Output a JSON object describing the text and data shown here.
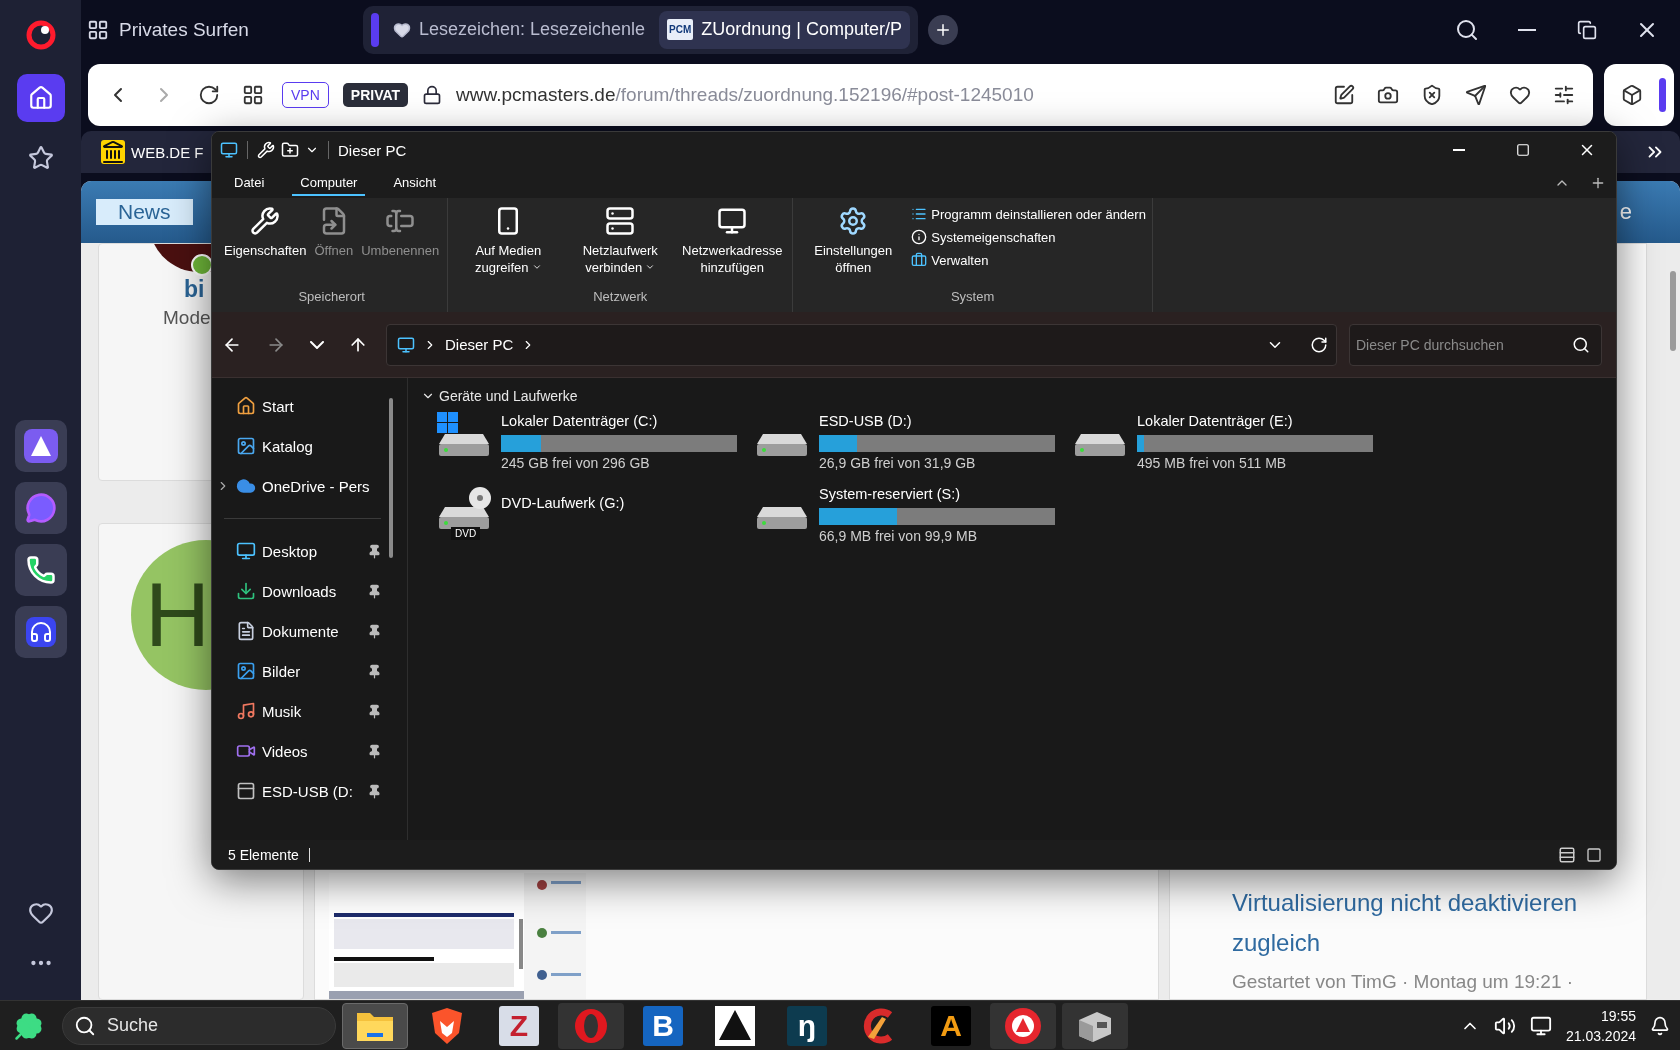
{
  "sidebar": {
    "items": [
      {
        "selected": true
      },
      {
        "selected": false
      }
    ]
  },
  "tab_bar": {
    "private_label": "Privates Surfen",
    "tabs": [
      {
        "title": "Lesezeichen: Lesezeichenle",
        "selected": false
      },
      {
        "favicon": "PCM",
        "title": "ZUordnung | Computer/P",
        "selected": true
      }
    ]
  },
  "address_bar": {
    "badges": [
      "VPN",
      "PRIVAT"
    ],
    "url_host": "www.pcmasters.de",
    "url_path": "/forum/threads/zuordnung.152196/#post-1245010"
  },
  "bookmarks": [
    "WEB.DE F"
  ],
  "page": {
    "tab": "News",
    "header_right": "e",
    "profile": {
      "name": "bi",
      "role": "Mode"
    },
    "avatar_letter": "H",
    "thread": {
      "title": "Virtualisierung nicht deaktivieren zugleich",
      "meta": "Gestartet von TimG · Montag um 19:21 ·"
    }
  },
  "explorer": {
    "title": "Dieser PC",
    "menu": [
      {
        "label": "Datei",
        "selected": false
      },
      {
        "label": "Computer",
        "selected": true
      },
      {
        "label": "Ansicht",
        "selected": false
      }
    ],
    "ribbon": [
      {
        "name": "Speicherort",
        "buttons": [
          {
            "label": "Eigenschaften",
            "disabled": false,
            "dropdown": false
          },
          {
            "label": "Öffnen",
            "disabled": true,
            "dropdown": false
          },
          {
            "label": "Umbenennen",
            "disabled": true,
            "dropdown": false
          }
        ]
      },
      {
        "name": "Netzwerk",
        "buttons": [
          {
            "label": "Auf Medien zugreifen",
            "disabled": false,
            "dropdown": true
          },
          {
            "label": "Netzlaufwerk verbinden",
            "disabled": false,
            "dropdown": true
          },
          {
            "label": "Netzwerkadresse hinzufügen",
            "disabled": false,
            "dropdown": false
          }
        ]
      },
      {
        "name": "System",
        "buttons": [
          {
            "label": "Einstellungen öffnen",
            "disabled": false,
            "dropdown": false
          }
        ],
        "links": [
          "Programm deinstallieren oder ändern",
          "Systemeigenschaften",
          "Verwalten"
        ]
      }
    ],
    "location": "Dieser PC",
    "search_placeholder": "Dieser PC durchsuchen",
    "nav_quick": [
      {
        "label": "Start"
      },
      {
        "label": "Katalog"
      },
      {
        "label": "OneDrive - Pers",
        "expanded": false
      }
    ],
    "nav_pinned": [
      {
        "label": "Desktop",
        "pinned": true
      },
      {
        "label": "Downloads",
        "pinned": true
      },
      {
        "label": "Dokumente",
        "pinned": true
      },
      {
        "label": "Bilder",
        "pinned": true
      },
      {
        "label": "Musik",
        "pinned": true
      },
      {
        "label": "Videos",
        "pinned": true
      },
      {
        "label": "ESD-USB (D:",
        "pinned": true
      }
    ],
    "section": "Geräte und Laufwerke",
    "section_expanded": true,
    "drives": [
      {
        "kind": "system",
        "name": "Lokaler Datenträger (C:)",
        "level": 0.17,
        "free": "245 GB frei von 296 GB"
      },
      {
        "kind": "disk",
        "name": "ESD-USB (D:)",
        "level": 0.16,
        "free": "26,9 GB frei von 31,9 GB"
      },
      {
        "kind": "disk",
        "name": "Lokaler Datenträger (E:)",
        "level": 0.03,
        "free": "495 MB frei von 511 MB"
      },
      {
        "kind": "dvd",
        "name": "DVD-Laufwerk (G:)",
        "icon_label": "DVD"
      },
      {
        "kind": "disk",
        "name": "System-reserviert (S:)",
        "level": 0.33,
        "free": "66,9 MB frei von 99,9 MB"
      }
    ],
    "status": "5 Elemente"
  },
  "taskbar": {
    "search_placeholder": "Suche",
    "apps": [
      {
        "open": true,
        "selected": true
      },
      {
        "open": false,
        "selected": false
      },
      {
        "glyph": "Z",
        "open": false,
        "selected": false
      },
      {
        "open": true,
        "selected": false
      },
      {
        "glyph": "B",
        "open": false,
        "selected": false
      },
      {
        "open": false,
        "selected": false
      },
      {
        "glyph": "ŋ",
        "open": false,
        "selected": false
      },
      {
        "open": false,
        "selected": false
      },
      {
        "glyph": "A",
        "open": false,
        "selected": false
      },
      {
        "open": true,
        "selected": false
      },
      {
        "open": true,
        "selected": false
      }
    ],
    "time": "19:55",
    "date": "21.03.2024"
  }
}
